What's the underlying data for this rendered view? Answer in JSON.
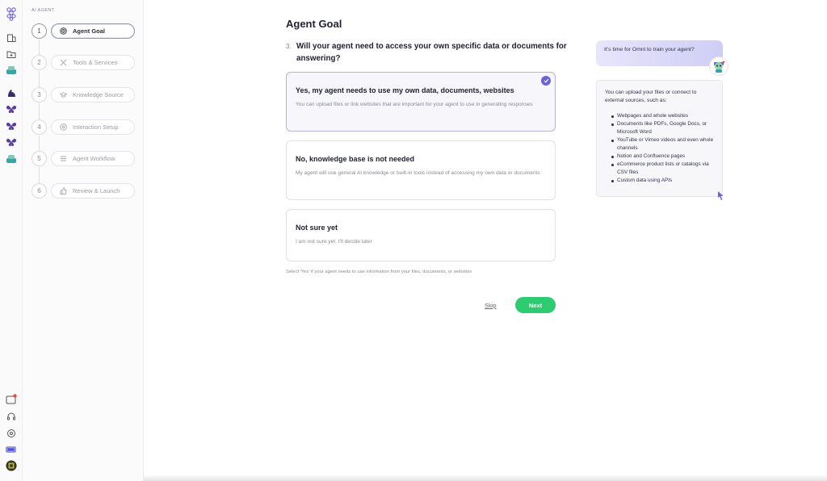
{
  "colors": {
    "accent": "#6c63d9",
    "success": "#2ecc71",
    "border": "#e0e0e8"
  },
  "rail": {
    "icons": [
      "logo-icon",
      "building-icon",
      "folder-plus-icon",
      "bot-icon",
      "muscle-icon",
      "butterfly-icon",
      "butterfly-icon",
      "butterfly-icon",
      "bot-icon"
    ],
    "bottom_icons": [
      "inbox-icon",
      "headset-icon",
      "settings-icon",
      "battery-icon",
      "avatar-icon"
    ]
  },
  "steps": {
    "kicker": "AI AGENT",
    "items": [
      {
        "num": "1",
        "label": "Agent Goal",
        "icon": "target-icon"
      },
      {
        "num": "2",
        "label": "Tools & Services",
        "icon": "tools-icon"
      },
      {
        "num": "3",
        "label": "Knowledge Source",
        "icon": "graduation-cap-icon"
      },
      {
        "num": "4",
        "label": "Interaction Setup",
        "icon": "chat-settings-icon"
      },
      {
        "num": "5",
        "label": "Agent Workflow",
        "icon": "list-icon"
      },
      {
        "num": "6",
        "label": "Review & Launch",
        "icon": "thumbs-up-icon"
      }
    ]
  },
  "main": {
    "title": "Agent Goal",
    "question_number": "3.",
    "question": "Will your agent need to access your own specific data or documents for answering?",
    "options": [
      {
        "title": "Yes, my agent needs to use my own data, documents, websites",
        "desc": "You can upload files or link websites that are important for your agent to use in generating responses",
        "selected": true
      },
      {
        "title": "No, knowledge base is not needed",
        "desc": "My agent will use general AI knowledge or built-in tools instead of accessing my own data or documents",
        "selected": false
      },
      {
        "title": "Not sure yet",
        "desc": "I am not sure yet. I'll decide later",
        "selected": false
      }
    ],
    "hint": "Select 'Yes' if your agent needs to use information from your files, documents, or websites",
    "skip_label": "Skip",
    "next_label": "Next"
  },
  "tips": {
    "bubble": "It's time for Omni to train your agent?",
    "intro": "You can upload your files or connect to external sources, such as:",
    "items": [
      "Webpages and whole websites",
      "Documents like PDFs, Google Docs, or Microsoft Word",
      "YouTube or Vimeo videos and even whole channels",
      "Notion and Confluence pages",
      "eCommerce product lists or catalogs via CSV files",
      "Custom data using APIs"
    ]
  }
}
